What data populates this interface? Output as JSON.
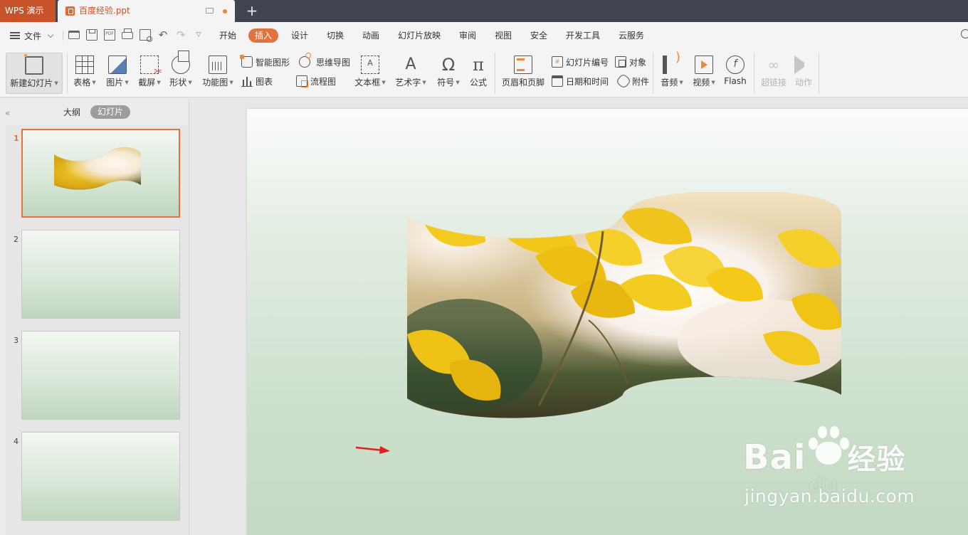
{
  "titlebar": {
    "app_name": "WPS 演示",
    "doc_tab": "百度经验.ppt",
    "add_tab": "+"
  },
  "menu": {
    "file": "文件",
    "tabs": [
      "开始",
      "插入",
      "设计",
      "切换",
      "动画",
      "幻灯片放映",
      "审阅",
      "视图",
      "安全",
      "开发工具",
      "云服务"
    ],
    "active_tab": "插入"
  },
  "ribbon": {
    "new_slide": "新建幻灯片",
    "table": "表格",
    "picture": "图片",
    "screenshot": "截屏",
    "shape": "形状",
    "function_chart": "功能图",
    "smart_art": "智能图形",
    "chart": "图表",
    "mind_map": "思维导图",
    "flow_chart": "流程图",
    "textbox": "文本框",
    "art_text": "艺术字",
    "symbol": "符号",
    "formula": "公式",
    "header_footer": "页眉和页脚",
    "slide_number": "幻灯片编号",
    "date_time": "日期和时间",
    "object": "对象",
    "attachment": "附件",
    "audio": "音频",
    "video": "视频",
    "flash": "Flash",
    "hyperlink": "超链接",
    "action": "动作"
  },
  "left_panel": {
    "tab_outline": "大纲",
    "tab_slides": "幻灯片",
    "slides": [
      {
        "number": "1",
        "has_image": true,
        "selected": true
      },
      {
        "number": "2",
        "has_image": false,
        "selected": false
      },
      {
        "number": "3",
        "has_image": false,
        "selected": false
      },
      {
        "number": "4",
        "has_image": false,
        "selected": false
      }
    ]
  },
  "watermark": {
    "logo_left": "Bai",
    "logo_right": "经验",
    "logo_du": "du",
    "url": "jingyan.baidu.com"
  },
  "colors": {
    "accent": "#e2733d",
    "app_tab": "#c8532a",
    "titlebar": "#40444e",
    "annotation_arrow": "#e02020"
  }
}
